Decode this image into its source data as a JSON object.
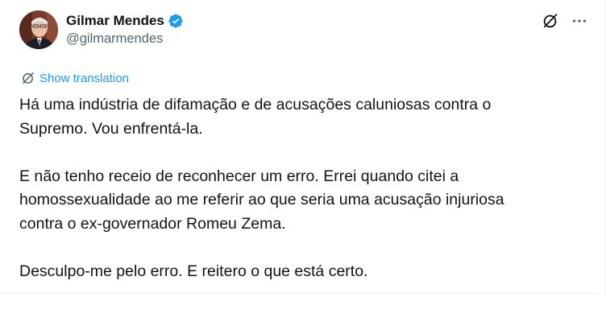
{
  "author": {
    "display_name": "Gilmar Mendes",
    "handle": "@gilmarmendes",
    "verified": true,
    "avatar_icon": "profile-photo"
  },
  "actions": {
    "grok_icon": "grok-icon",
    "more_icon": "more-options-icon"
  },
  "translation": {
    "label": "Show translation",
    "icon": "translate-icon"
  },
  "tweet": {
    "lines": [
      "Há uma indústria de difamação e de acusações caluniosas contra o",
      "Supremo. Vou enfrentá-la.",
      "E não tenho receio de reconhecer um erro. Errei quando citei a",
      "homossexualidade ao me referir ao que seria uma acusação injuriosa",
      "contra o ex-governador Romeu Zema.",
      "Desculpo-me pelo erro. E reitero o que está certo."
    ]
  },
  "colors": {
    "text": "#0f1419",
    "secondary_text": "#536471",
    "link_blue": "#1d9bf0",
    "verified_blue": "#1d9bf0"
  }
}
